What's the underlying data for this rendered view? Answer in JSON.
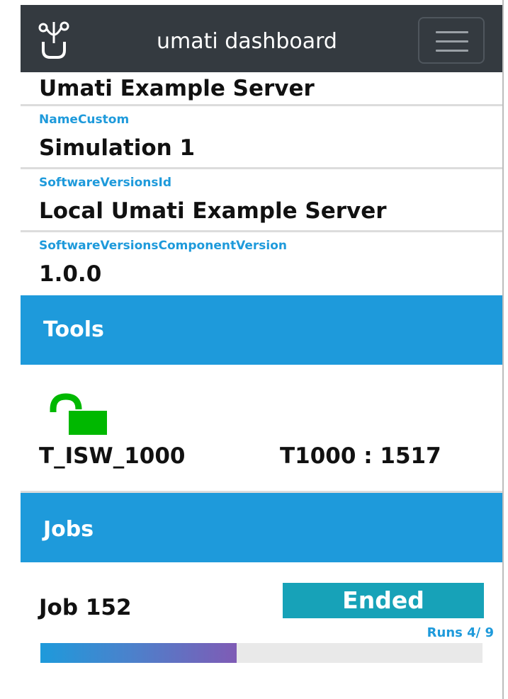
{
  "navbar": {
    "brand": "umati dashboard",
    "logo_icon": "umati-logo-icon",
    "menu_icon": "hamburger-menu-icon"
  },
  "info": {
    "server_name": "Umati Example Server",
    "fields": [
      {
        "label": "NameCustom",
        "value": "Simulation 1"
      },
      {
        "label": "SoftwareVersionsId",
        "value": "Local Umati Example Server"
      },
      {
        "label": "SoftwareVersionsComponentVersion",
        "value": "1.0.0"
      }
    ]
  },
  "tools": {
    "title": "Tools",
    "items": [
      {
        "name": "T_ISW_1000",
        "id": "T1000 : 1517",
        "lock_state": "unlocked",
        "lock_color": "#00b800"
      }
    ]
  },
  "jobs": {
    "title": "Jobs",
    "items": [
      {
        "name": "Job 152",
        "status": "Ended",
        "runs_text": "Runs 4/ 9",
        "runs_done": 4,
        "runs_total": 9
      }
    ]
  },
  "colors": {
    "navbar_bg": "#343a40",
    "accent": "#1e9adb",
    "status_ended": "#17a2b8",
    "lock_green": "#00b800"
  }
}
